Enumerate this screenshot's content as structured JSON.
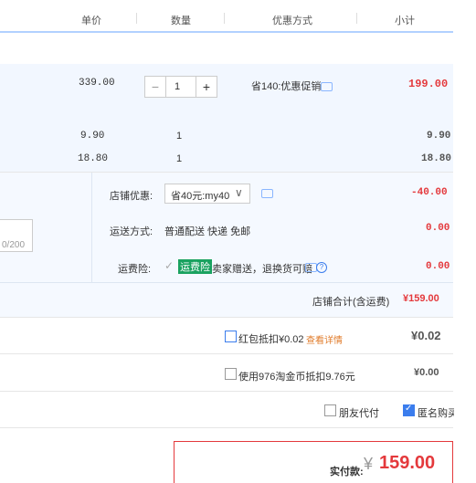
{
  "header": {
    "unit_price": "单价",
    "quantity": "数量",
    "discount_method": "优惠方式",
    "subtotal": "小计"
  },
  "main_item": {
    "unit_price": "339.00",
    "quantity": "1",
    "minus": "−",
    "plus": "+",
    "discount": "省140:优惠促销",
    "subtotal": "199.00"
  },
  "extra_items": [
    {
      "unit_price": "9.90",
      "quantity": "1",
      "subtotal": "9.90"
    },
    {
      "unit_price": "18.80",
      "quantity": "1",
      "subtotal": "18.80"
    }
  ],
  "shop": {
    "discount_label": "店铺优惠:",
    "discount_select": "省40元:my40",
    "discount_amount": "-40.00",
    "shipping_label": "运送方式:",
    "shipping_value": "普通配送 快递 免邮",
    "shipping_amount": "0.00",
    "insurance_label": "运费险:",
    "insurance_tag": "运费险",
    "insurance_text": "卖家赠送，退换货可赔",
    "insurance_amount": "0.00",
    "message_count": "0/200",
    "total_label": "店铺合计(含运费)",
    "total_value": "¥159.00"
  },
  "redpacket": {
    "label": "红包抵扣¥0.02",
    "link": "查看详情",
    "amount": "¥0.02"
  },
  "coin": {
    "label": "使用976淘金币抵扣9.76元",
    "amount": "¥0.00"
  },
  "options": {
    "friend_pay": "朋友代付",
    "anonymous": "匿名购买"
  },
  "pay": {
    "label": "实付款:",
    "currency": "¥",
    "amount": "159.00"
  },
  "colors": {
    "accent": "#e4393c",
    "border_blue": "#b2d1ff",
    "row_bg": "#f2f7ff"
  }
}
